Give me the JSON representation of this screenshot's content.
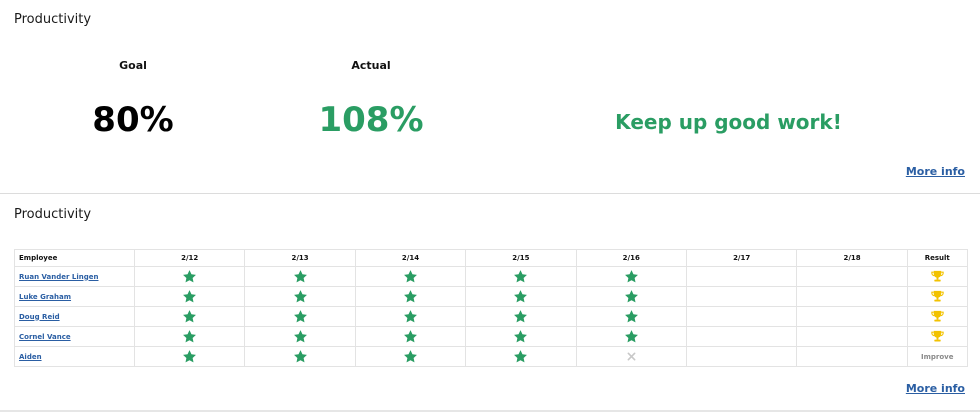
{
  "summary": {
    "title": "Productivity",
    "goal_label": "Goal",
    "goal_value": "80%",
    "actual_label": "Actual",
    "actual_value": "108%",
    "message": "Keep up good work!",
    "more_info": "More info"
  },
  "table_panel": {
    "title": "Productivity",
    "more_info": "More info"
  },
  "table": {
    "employee_header": "Employee",
    "date_headers": [
      "2/12",
      "2/13",
      "2/14",
      "2/15",
      "2/16",
      "2/17",
      "2/18"
    ],
    "result_header": "Result",
    "rows": [
      {
        "employee": "Ruan Vander Lingen",
        "days": [
          "star",
          "star",
          "star",
          "star",
          "star",
          "",
          ""
        ],
        "result_icon": "trophy-icon",
        "result_text": ""
      },
      {
        "employee": "Luke Graham",
        "days": [
          "star",
          "star",
          "star",
          "star",
          "star",
          "",
          ""
        ],
        "result_icon": "trophy-icon",
        "result_text": ""
      },
      {
        "employee": "Doug Reid",
        "days": [
          "star",
          "star",
          "star",
          "star",
          "star",
          "",
          ""
        ],
        "result_icon": "trophy-icon",
        "result_text": ""
      },
      {
        "employee": "Cornel Vance",
        "days": [
          "star",
          "star",
          "star",
          "star",
          "star",
          "",
          ""
        ],
        "result_icon": "trophy-icon",
        "result_text": ""
      },
      {
        "employee": "Aiden",
        "days": [
          "star",
          "star",
          "star",
          "star",
          "x",
          "",
          ""
        ],
        "result_icon": "",
        "result_text": "Improve"
      }
    ]
  },
  "colors": {
    "accent_green": "#2a9d63",
    "link_blue": "#2a5ea3",
    "trophy_gold": "#f2c200",
    "x_gray": "#c8c8c8"
  }
}
